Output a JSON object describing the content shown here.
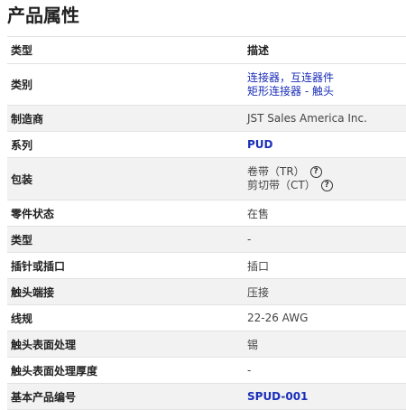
{
  "title": "产品属性",
  "header": {
    "type": "类型",
    "desc": "描述"
  },
  "rows": {
    "category": {
      "key": "类别",
      "links": [
        "连接器，互连器件",
        "矩形连接器 - 触头"
      ]
    },
    "manufacturer": {
      "key": "制造商",
      "value": "JST Sales America Inc."
    },
    "series": {
      "key": "系列",
      "value": "PUD"
    },
    "packaging": {
      "key": "包装",
      "lines": [
        "卷带（TR）",
        "剪切带（CT）"
      ],
      "help_icon": "question-circle-icon"
    },
    "part_status": {
      "key": "零件状态",
      "value": "在售"
    },
    "type": {
      "key": "类型",
      "value": "-"
    },
    "pin_or_socket": {
      "key": "插针或插口",
      "value": "插口"
    },
    "contact_termination": {
      "key": "触头端接",
      "value": "压接"
    },
    "wire_gauge": {
      "key": "线规",
      "value": "22-26 AWG"
    },
    "contact_finish": {
      "key": "触头表面处理",
      "value": "锡"
    },
    "contact_finish_thickness": {
      "key": "触头表面处理厚度",
      "value": "-"
    },
    "base_part_number": {
      "key": "基本产品编号",
      "value": "SPUD-001"
    }
  },
  "colors": {
    "link": "#1a2eb8",
    "row_alt": "#f2f2f2",
    "divider": "#e2e2e2"
  }
}
